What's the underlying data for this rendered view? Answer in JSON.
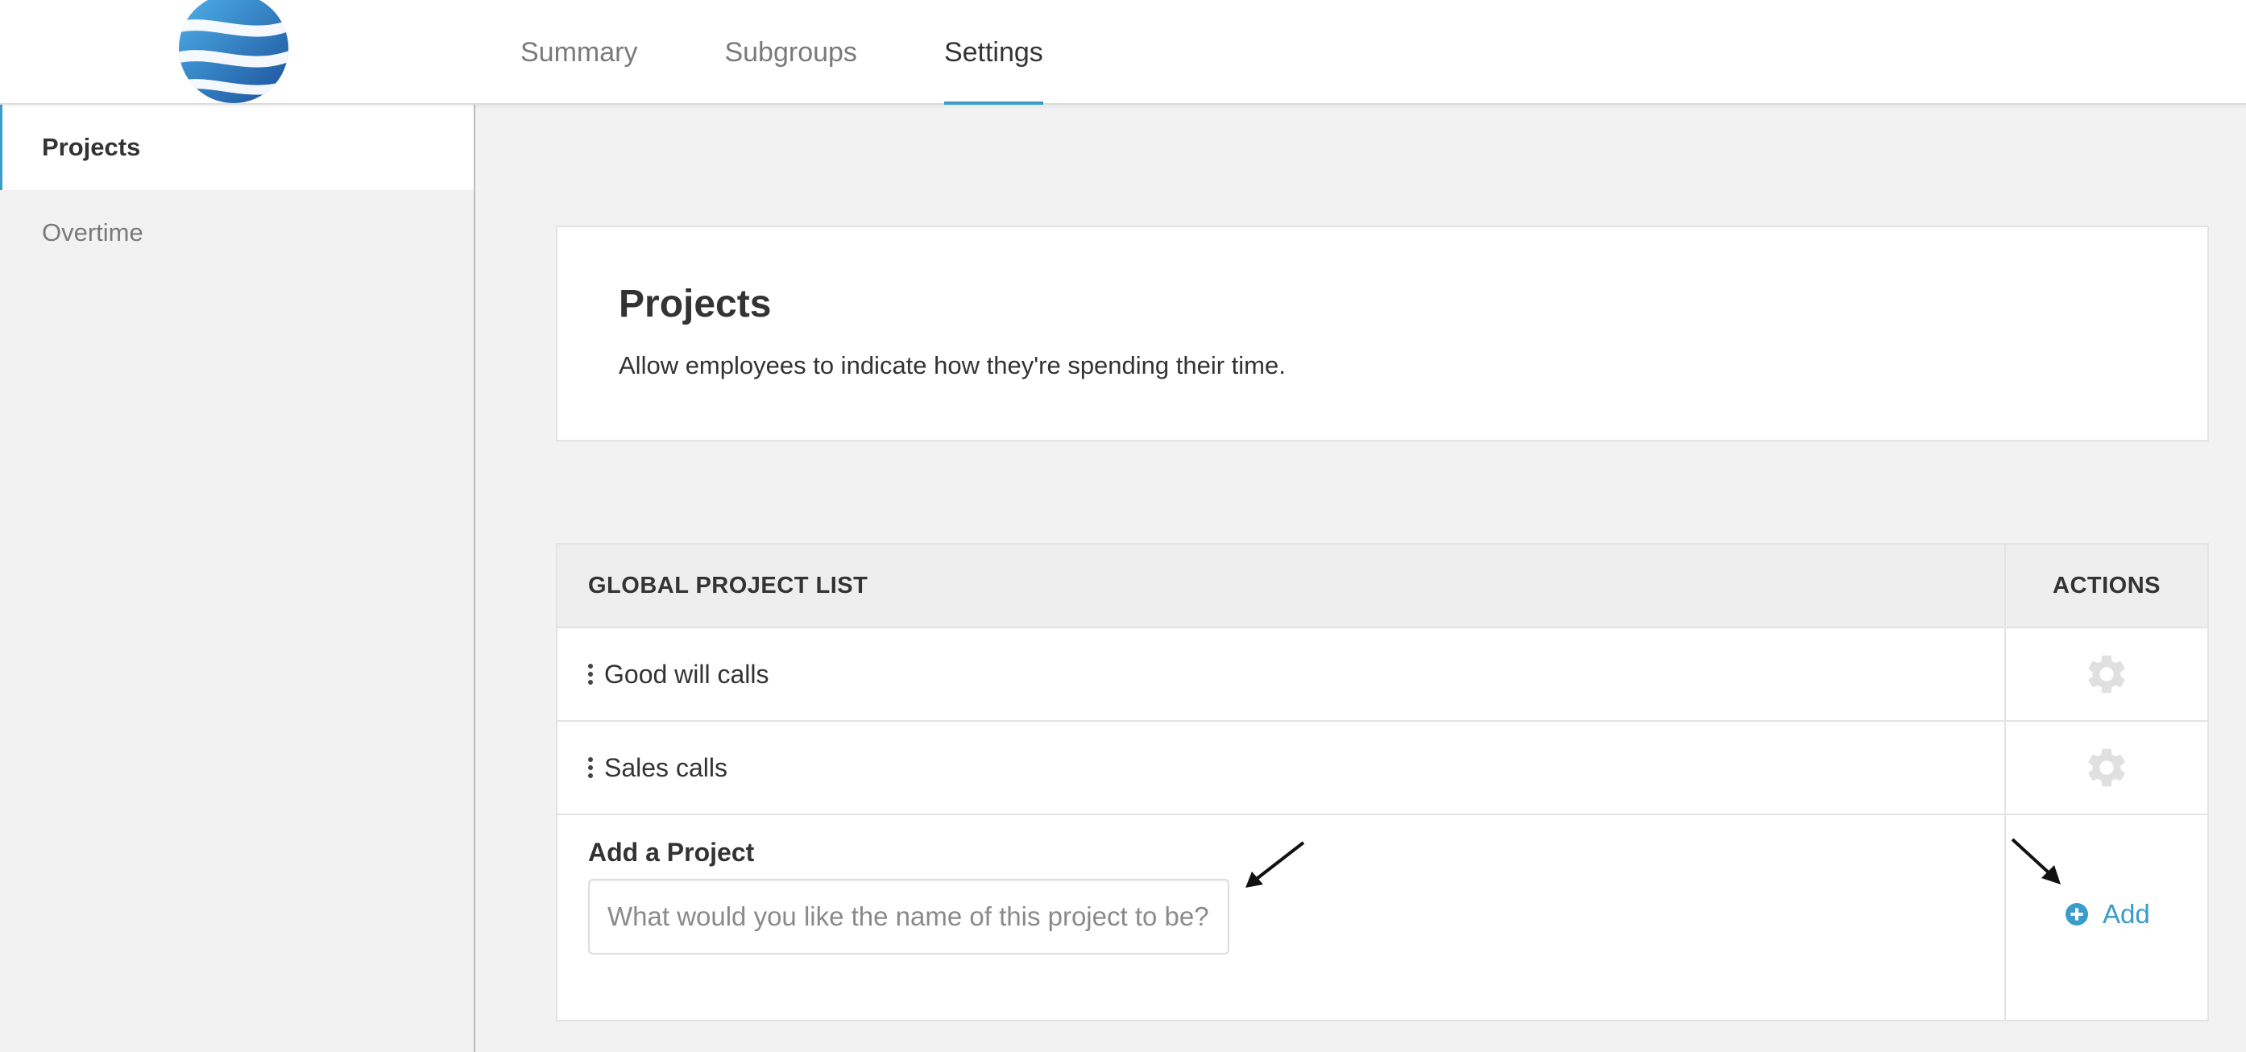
{
  "header": {
    "logo_icon": "globe-logo-icon",
    "tabs": [
      {
        "label": "Summary",
        "active": false
      },
      {
        "label": "Subgroups",
        "active": false
      },
      {
        "label": "Settings",
        "active": true
      }
    ]
  },
  "sidebar": {
    "items": [
      {
        "label": "Projects",
        "active": true
      },
      {
        "label": "Overtime",
        "active": false
      }
    ]
  },
  "intro": {
    "title": "Projects",
    "description": "Allow employees to indicate how they're spending their time."
  },
  "project_table": {
    "header_list": "GLOBAL PROJECT LIST",
    "header_actions": "ACTIONS",
    "rows": [
      {
        "name": "Good will calls",
        "action_icon": "gear-icon"
      },
      {
        "name": "Sales calls",
        "action_icon": "gear-icon"
      }
    ],
    "add": {
      "label": "Add a Project",
      "placeholder": "What would you like the name of this project to be?",
      "value": "",
      "button_label": "Add",
      "button_icon": "plus-circle-icon"
    }
  },
  "colors": {
    "accent": "#3a9ccc",
    "gear": "#e0e0e0",
    "background": "#f2f2f2"
  }
}
